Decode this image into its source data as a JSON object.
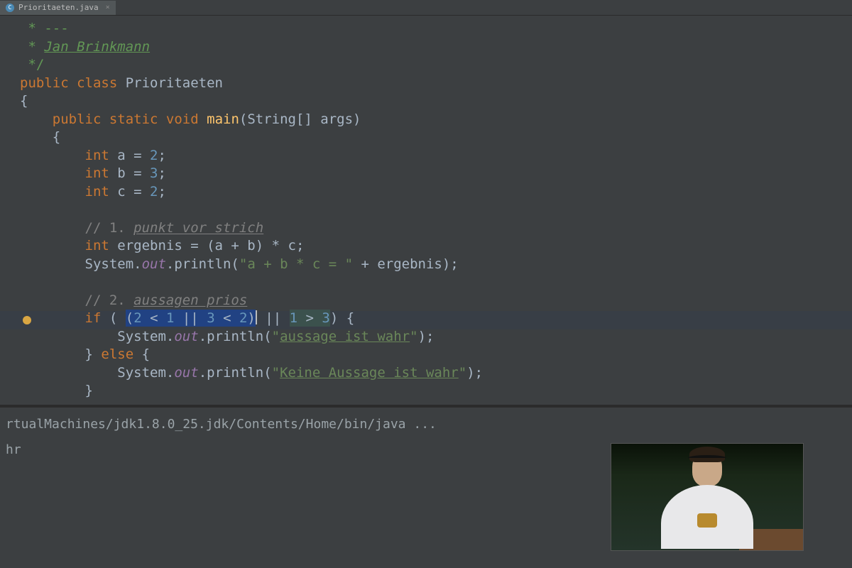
{
  "tab": {
    "filename": "Prioritaeten.java",
    "icon_letter": "C"
  },
  "code": {
    "doc1": " * ---",
    "doc2_pre": " * ",
    "doc2_author": "Jan Brinkmann",
    "doc3": " */",
    "cls_pub": "public ",
    "cls_class": "class ",
    "cls_name": "Prioritaeten",
    "brace_o": "{",
    "m_pub": "public ",
    "m_static": "static ",
    "m_void": "void ",
    "m_main": "main",
    "m_sig": "(String[] args)",
    "ind2_brace": "    {",
    "v1_t": "int ",
    "v1_r": "a = ",
    "v1_n": "2",
    "v1_s": ";",
    "v2_t": "int ",
    "v2_r": "b = ",
    "v2_n": "3",
    "v2_s": ";",
    "v3_t": "int ",
    "v3_r": "c = ",
    "v3_n": "2",
    "v3_s": ";",
    "c1_a": "// 1. ",
    "c1_b": "punkt vor strich",
    "e1_t": "int ",
    "e1_r": "ergebnis = (a + b) * c;",
    "p1_a": "System.",
    "p1_out": "out",
    "p1_b": ".println(",
    "p1_s": "\"a + b * c = \"",
    "p1_c": " + ergebnis);",
    "c2_a": "// 2. ",
    "c2_b": "aussagen prios",
    "if_kw": "if ",
    "if_a": "( ",
    "if_sel_p": "(",
    "if_sel_n1": "2",
    "if_sel_m1": " < ",
    "if_sel_n2": "1",
    "if_sel_m2": " || ",
    "if_sel_n3": "3",
    "if_sel_m3": " < ",
    "if_sel_n4": "2",
    "if_sel_pe": ")",
    "if_b": " || ",
    "if_n5": "1",
    "if_m4": " > ",
    "if_n6": "3",
    "if_c": ") {",
    "p2_a": "System.",
    "p2_out": "out",
    "p2_b": ".println(",
    "p2_s1": "\"",
    "p2_s2": "aussage ist wahr",
    "p2_s3": "\"",
    "p2_c": ");",
    "else_a": "} ",
    "else_kw": "else ",
    "else_b": "{",
    "p3_a": "System.",
    "p3_out": "out",
    "p3_b": ".println(",
    "p3_s1": "\"",
    "p3_s2": "Keine Aussage ist wahr",
    "p3_s3": "\"",
    "p3_c": ");",
    "close_b": "}"
  },
  "terminal": {
    "line1": "rtualMachines/jdk1.8.0_25.jdk/Contents/Home/bin/java ...",
    "line2": "hr"
  }
}
